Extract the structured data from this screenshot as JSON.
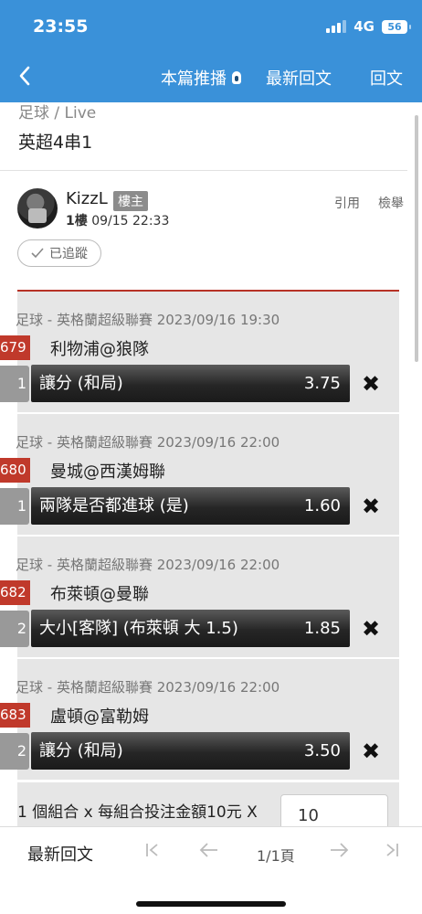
{
  "status": {
    "time": "23:55",
    "network": "4G",
    "battery": "56"
  },
  "nav": {
    "push_label": "本篇推播",
    "latest_label": "最新回文",
    "reply_label": "回文"
  },
  "header": {
    "breadcrumb": "足球 / Live",
    "title": "英超4串1"
  },
  "post": {
    "author": "KizzL",
    "badge": "樓主",
    "floor": "1樓",
    "datetime": "09/15 22:33",
    "quote_label": "引用",
    "report_label": "檢舉",
    "follow_label": "已追蹤"
  },
  "bets": [
    {
      "meta": "足球 - 英格蘭超級聯賽 2023/09/16 19:30",
      "code": "679",
      "match": "利物浦@狼隊",
      "idx": "1",
      "pick": "讓分 (和局)",
      "odds": "3.75"
    },
    {
      "meta": "足球 - 英格蘭超級聯賽 2023/09/16 22:00",
      "code": "680",
      "match": "曼城@西漢姆聯",
      "idx": "1",
      "pick": "兩隊是否都進球 (是)",
      "odds": "1.60"
    },
    {
      "meta": "足球 - 英格蘭超級聯賽 2023/09/16 22:00",
      "code": "682",
      "match": "布萊頓@曼聯",
      "idx": "2",
      "pick": "大小[客隊] (布萊頓 大 1.5)",
      "odds": "1.85"
    },
    {
      "meta": "足球 - 英格蘭超級聯賽 2023/09/16 22:00",
      "code": "683",
      "match": "盧頓@富勒姆",
      "idx": "2",
      "pick": "讓分 (和局)",
      "odds": "3.50"
    }
  ],
  "combo": {
    "text": "1 個組合 x 每組合投注金額10元 X",
    "amount": "10"
  },
  "bottom": {
    "latest_label": "最新回文",
    "page": "1/1頁"
  },
  "colors": {
    "header_bg": "#3a91d9",
    "accent_red": "#c0392b"
  }
}
